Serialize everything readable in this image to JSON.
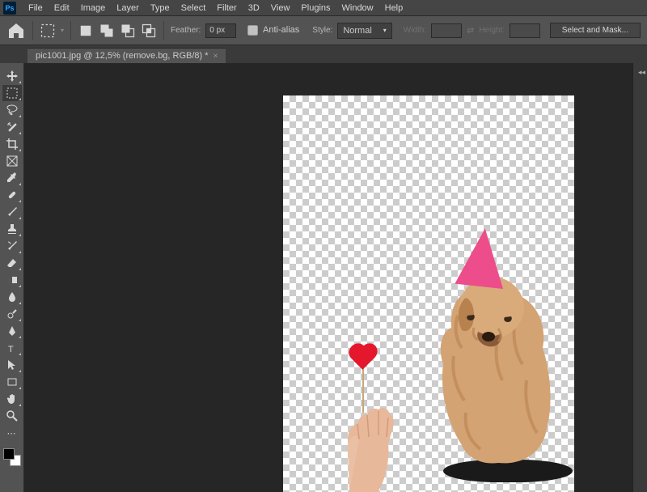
{
  "menu": [
    "File",
    "Edit",
    "Image",
    "Layer",
    "Type",
    "Select",
    "Filter",
    "3D",
    "View",
    "Plugins",
    "Window",
    "Help"
  ],
  "options": {
    "feather_label": "Feather:",
    "feather_value": "0 px",
    "antialias": "Anti-alias",
    "style_label": "Style:",
    "style_value": "Normal",
    "width_label": "Width:",
    "height_label": "Height:",
    "mask_btn": "Select and Mask..."
  },
  "tab": {
    "title": "pic1001.jpg @ 12,5% (remove.bg, RGB/8) *",
    "close": "×"
  },
  "tools": [
    "move",
    "marquee",
    "lasso",
    "wand",
    "crop",
    "frame",
    "eyedropper",
    "healing",
    "brush",
    "stamp",
    "history-brush",
    "eraser",
    "gradient",
    "blur",
    "dodge",
    "pen",
    "type",
    "path-select",
    "rectangle",
    "hand",
    "zoom",
    "extra"
  ]
}
